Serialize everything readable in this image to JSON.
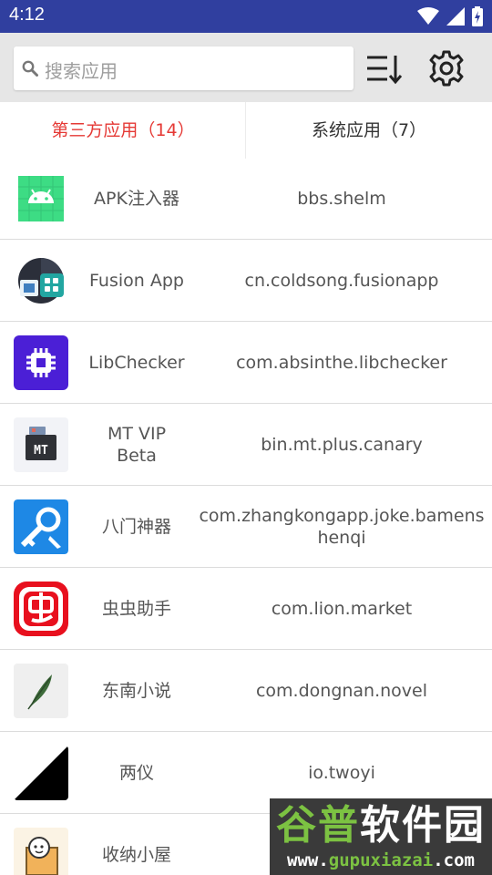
{
  "status_bar": {
    "time": "4:12",
    "icons": [
      "wifi-icon",
      "signal-icon",
      "battery-icon"
    ]
  },
  "toolbar": {
    "search_placeholder": "搜索应用",
    "icons": [
      "sort-icon",
      "settings-gear-icon"
    ]
  },
  "tabs": [
    {
      "label": "第三方应用（14）",
      "active": true
    },
    {
      "label": "系统应用（7）",
      "active": false
    }
  ],
  "apps": [
    {
      "name": "APK注入器",
      "package": "bbs.shelm",
      "icon": "android-icon"
    },
    {
      "name": "Fusion App",
      "package": "cn.coldsong.fusionapp",
      "icon": "fusion-app-icon"
    },
    {
      "name": "LibChecker",
      "package": "com.absinthe.libchecker",
      "icon": "libchecker-chip-icon"
    },
    {
      "name": "MT VIP\nBeta",
      "package": "bin.mt.plus.canary",
      "icon": "mt-manager-icon"
    },
    {
      "name": "八门神器",
      "package": "com.zhangkongapp.joke.bamenshenqi",
      "icon": "bamen-key-icon"
    },
    {
      "name": "虫虫助手",
      "package": "com.lion.market",
      "icon": "chongchong-icon"
    },
    {
      "name": "东南小说",
      "package": "com.dongnan.novel",
      "icon": "feather-icon"
    },
    {
      "name": "两仪",
      "package": "io.twoyi",
      "icon": "twoyi-triangle-icon"
    },
    {
      "name": "收纳小屋",
      "package": "",
      "icon": "cartoon-box-icon"
    }
  ],
  "colors": {
    "status_bar": "#303f9f",
    "toolbar": "#e6e6e6",
    "active_tab": "#e53935"
  },
  "watermark": {
    "logo_text": "谷普软件园",
    "url": "www.gupuxiazai.com"
  }
}
